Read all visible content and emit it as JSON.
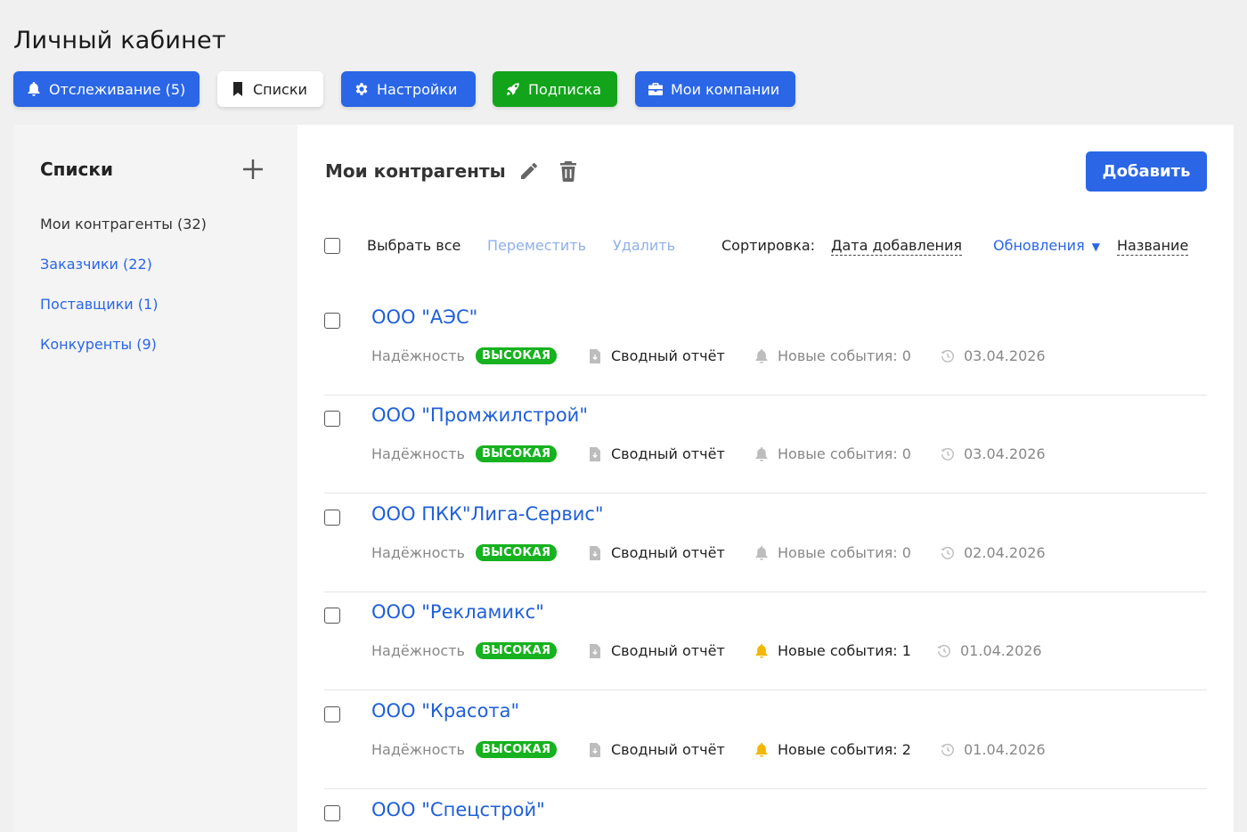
{
  "page": {
    "title": "Личный кабинет"
  },
  "topnav": {
    "items": [
      {
        "label": "Отслеживание (5)",
        "icon": "bell-icon",
        "style": "blue"
      },
      {
        "label": "Списки",
        "icon": "bookmark-icon",
        "style": "white"
      },
      {
        "label": "Настройки",
        "icon": "gear-icon",
        "style": "blue"
      },
      {
        "label": "Подписка",
        "icon": "rocket-icon",
        "style": "green"
      },
      {
        "label": "Мои компании",
        "icon": "briefcase-icon",
        "style": "blue"
      }
    ]
  },
  "sidebar": {
    "title": "Списки",
    "items": [
      {
        "label": "Мои контрагенты (32)",
        "active": true
      },
      {
        "label": "Заказчики (22)",
        "active": false
      },
      {
        "label": "Поставщики (1)",
        "active": false
      },
      {
        "label": "Конкуренты (9)",
        "active": false
      }
    ]
  },
  "main": {
    "title": "Мои контрагенты",
    "add_label": "Добавить",
    "toolbar": {
      "select_all": "Выбрать все",
      "move": "Переместить",
      "delete": "Удалить",
      "sort_label": "Сортировка:",
      "sort_options": [
        "Дата добавления",
        "Обновления",
        "Название"
      ]
    },
    "rows": [
      {
        "name": "ООО \"АЭС\"",
        "reliability_label": "Надёжность",
        "reliability": "ВЫСОКАЯ",
        "report": "Сводный отчёт",
        "events": "Новые события: 0",
        "date": "03.04.2026"
      },
      {
        "name": "ООО \"Промжилстрой\"",
        "reliability_label": "Надёжность",
        "reliability": "ВЫСОКАЯ",
        "report": "Сводный отчёт",
        "events": "Новые события: 0",
        "date": "03.04.2026"
      },
      {
        "name": "ООО ПКК\"Лига-Сервис\"",
        "reliability_label": "Надёжность",
        "reliability": "ВЫСОКАЯ",
        "report": "Сводный отчёт",
        "events": "Новые события: 0",
        "date": "02.04.2026"
      },
      {
        "name": "ООО \"Рекламикс\"",
        "reliability_label": "Надёжность",
        "reliability": "ВЫСОКАЯ",
        "report": "Сводный отчёт",
        "events": "Новые события: 1",
        "date": "01.04.2026"
      },
      {
        "name": "ООО \"Красота\"",
        "reliability_label": "Надёжность",
        "reliability": "ВЫСОКАЯ",
        "report": "Сводный отчёт",
        "events": "Новые события: 2",
        "date": "01.04.2026"
      },
      {
        "name": "ООО \"Спецстрой\""
      }
    ]
  },
  "colors": {
    "accent_blue": "#2a66e6",
    "subscription_green": "#12a41a",
    "badge_green": "#16b21f",
    "event_yellow": "#f2b705"
  }
}
